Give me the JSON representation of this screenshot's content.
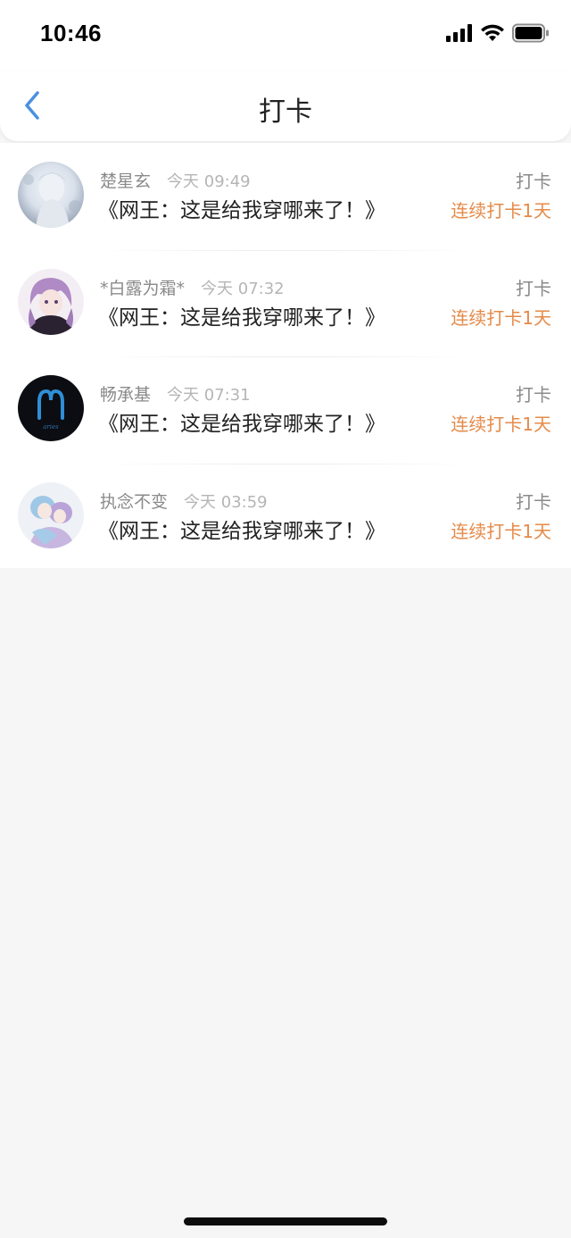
{
  "status_bar": {
    "time": "10:46",
    "icons": [
      "signal-icon",
      "wifi-icon",
      "battery-icon"
    ]
  },
  "nav": {
    "back_icon": "chevron-left-icon",
    "title": "打卡"
  },
  "colors": {
    "accent_blue": "#4a90e2",
    "streak_orange": "#e58a48",
    "background": "#f6f6f6"
  },
  "checkins": [
    {
      "avatar": "avatar-light-anime",
      "name": "楚星玄",
      "time": "今天 09:49",
      "title": "《网王：这是给我穿哪来了！》",
      "action": "打卡",
      "streak": "连续打卡1天"
    },
    {
      "avatar": "avatar-purple-anime",
      "name": "*白露为霜*",
      "time": "今天 07:32",
      "title": "《网王：这是给我穿哪来了！》",
      "action": "打卡",
      "streak": "连续打卡1天"
    },
    {
      "avatar": "avatar-aries-sign",
      "name": "畅承基",
      "time": "今天 07:31",
      "title": "《网王：这是给我穿哪来了！》",
      "action": "打卡",
      "streak": "连续打卡1天"
    },
    {
      "avatar": "avatar-pastel-anime",
      "name": "执念不变",
      "time": "今天 03:59",
      "title": "《网王：这是给我穿哪来了！》",
      "action": "打卡",
      "streak": "连续打卡1天"
    }
  ]
}
